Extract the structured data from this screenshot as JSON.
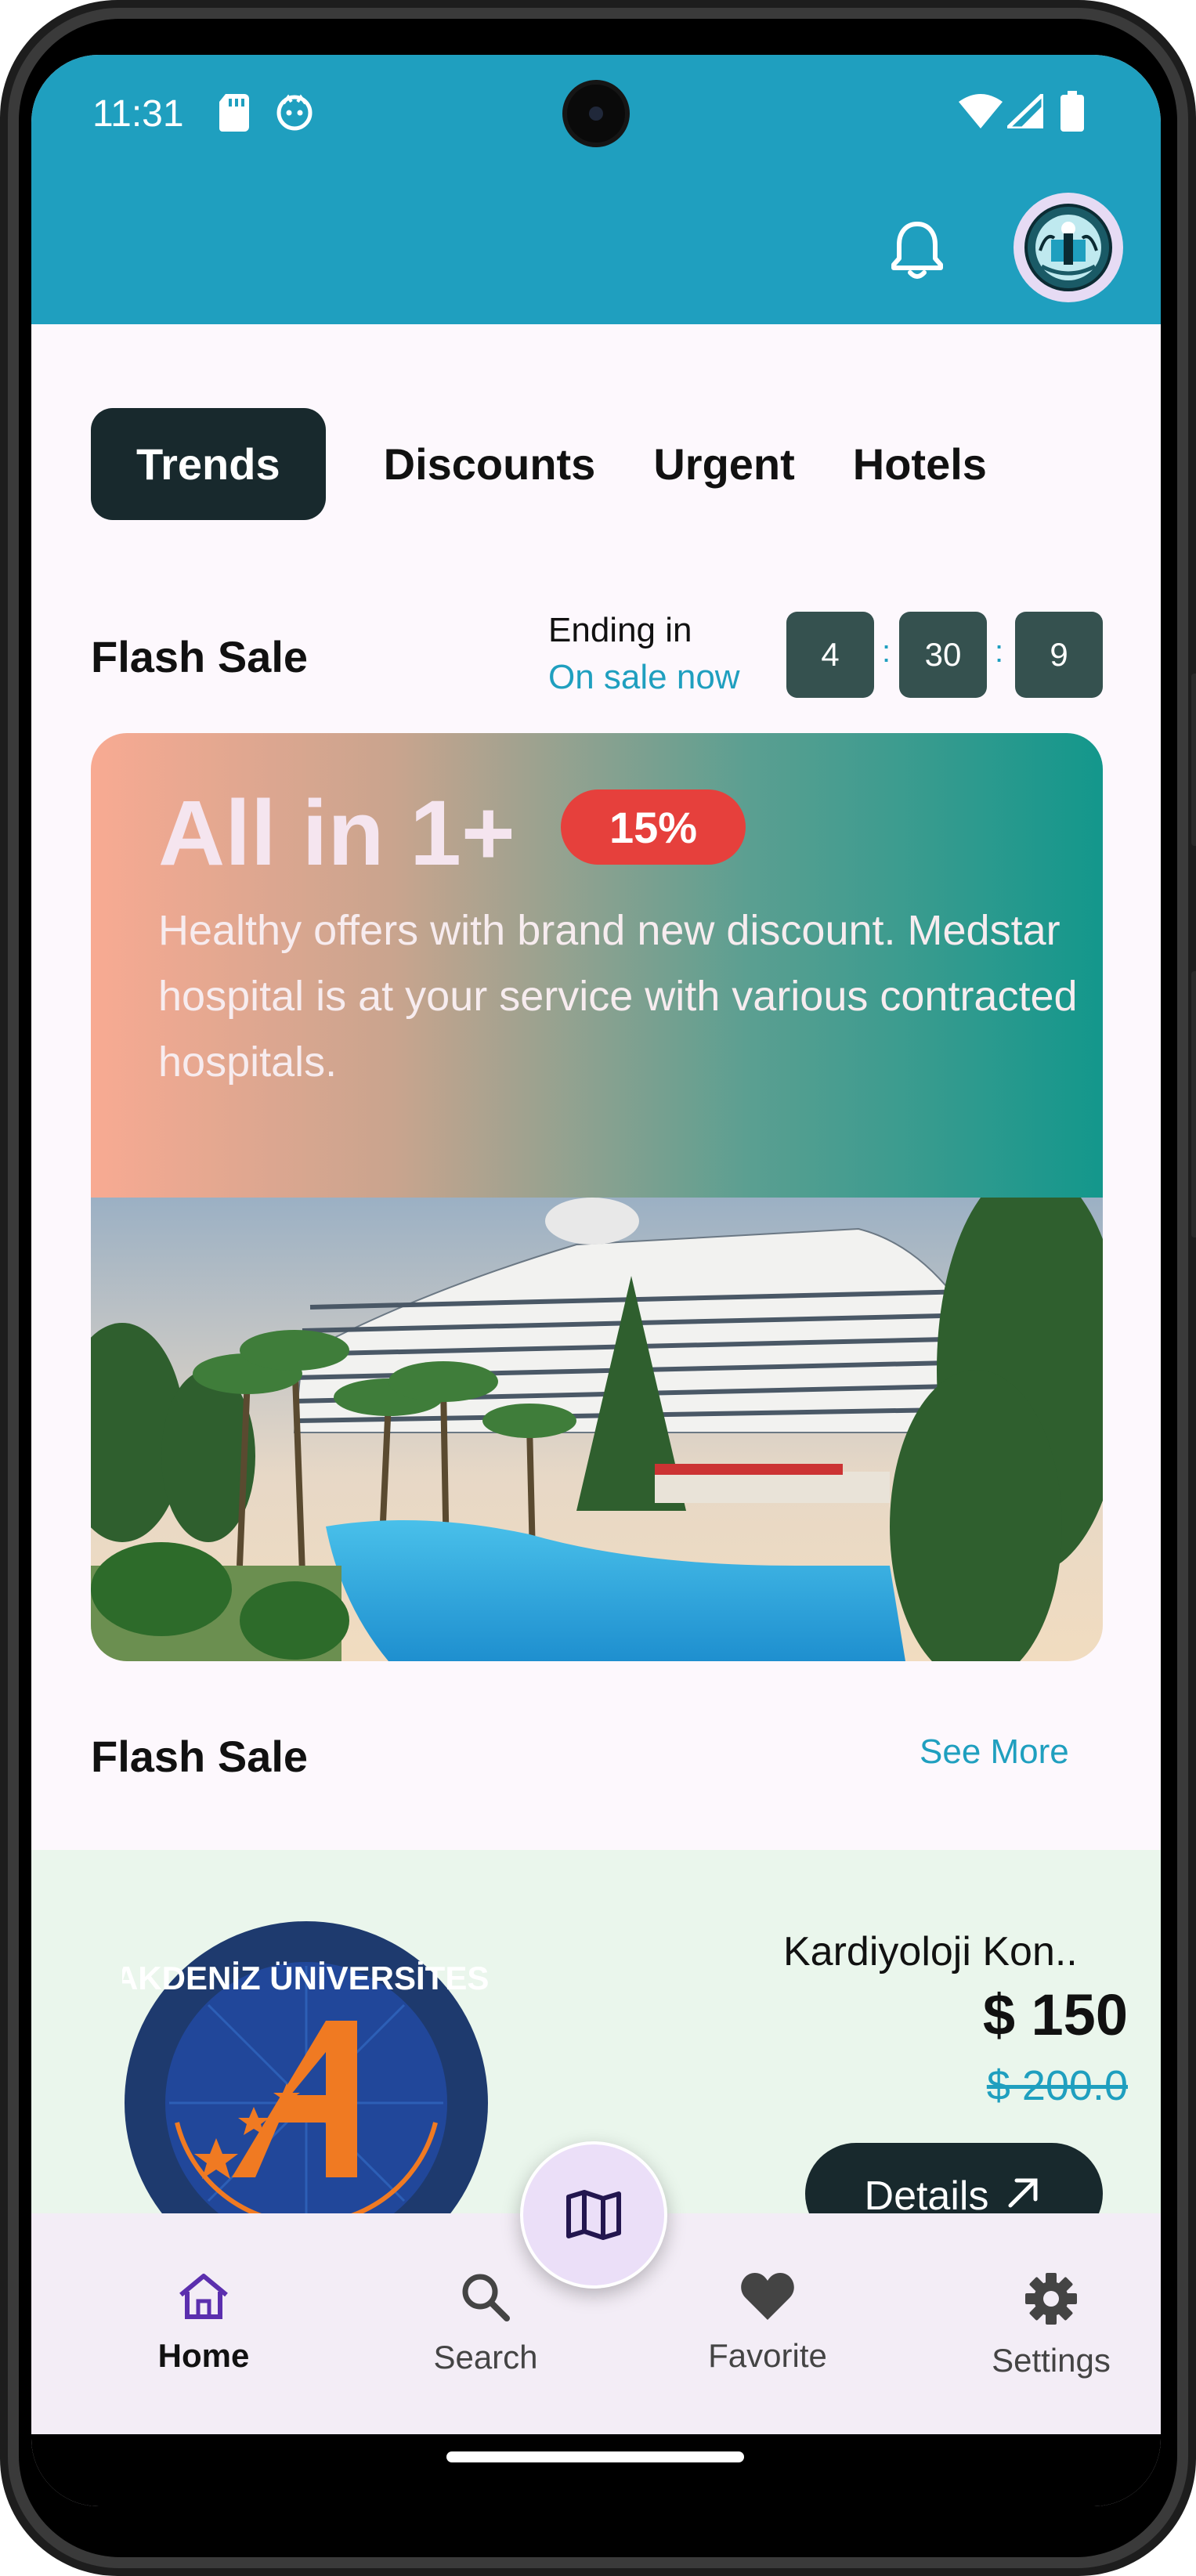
{
  "status_bar": {
    "time": "11:31"
  },
  "tabs": [
    "Trends",
    "Discounts",
    "Urgent",
    "Hotels"
  ],
  "flash_sale": {
    "title": "Flash Sale",
    "ending_label": "Ending in",
    "status": "On sale now",
    "timer": {
      "hours": "4",
      "minutes": "30",
      "seconds": "9",
      "separator": ":"
    }
  },
  "promo": {
    "title": "All in 1+",
    "badge": "15%",
    "description": "Healthy offers with brand new discount. Medstar hospital is at your service with various contracted hospitals."
  },
  "flash_sale_list": {
    "title": "Flash Sale",
    "see_more": "See More",
    "product": {
      "name": "Kardiyoloji Kon..",
      "price": "$ 150",
      "old_price": "$ 200.0",
      "button": "Details",
      "logo_text": "AKDENİZ ÜNİVERSİTESİ"
    }
  },
  "bottom_nav": {
    "items": [
      {
        "label": "Home",
        "icon": "home-icon",
        "active": true
      },
      {
        "label": "Search",
        "icon": "search-icon",
        "active": false
      },
      {
        "label": "Favorite",
        "icon": "heart-icon",
        "active": false
      },
      {
        "label": "Settings",
        "icon": "gear-icon",
        "active": false
      }
    ],
    "fab_icon": "map-icon"
  },
  "colors": {
    "header": "#1f9fbf",
    "tab_active": "#18292d",
    "accent": "#1f9fbf",
    "badge": "#e6403c",
    "nav_active": "#5b2fae"
  }
}
